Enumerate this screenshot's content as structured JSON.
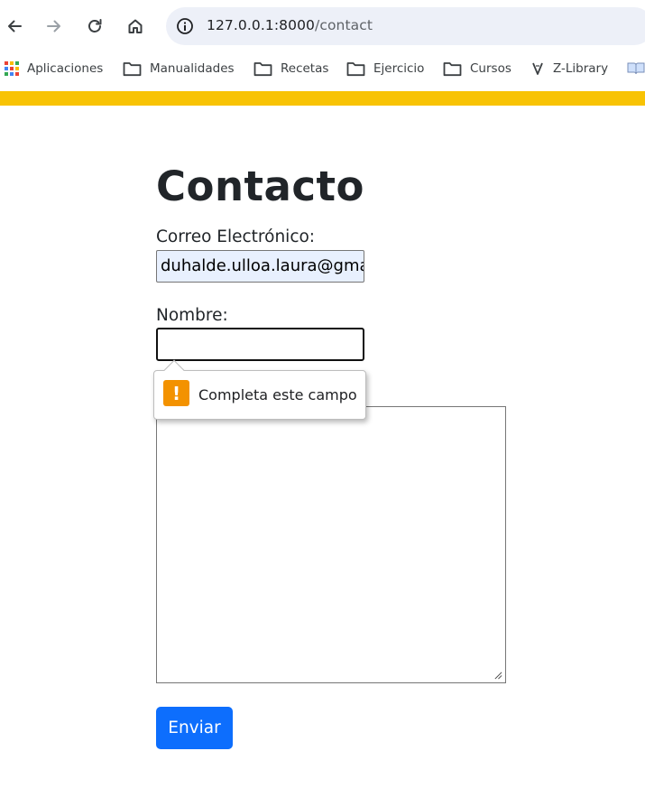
{
  "browser": {
    "url_host": "127.0.0.1:8000",
    "url_path": "/contact",
    "icons": {
      "back": "arrow-left-icon",
      "forward": "arrow-right-icon",
      "reload": "reload-icon",
      "home": "home-icon",
      "site_info": "info-icon"
    }
  },
  "bookmarks": [
    {
      "label": "Aplicaciones",
      "icon": "apps-grid-icon"
    },
    {
      "label": "Manualidades",
      "icon": "folder-icon"
    },
    {
      "label": "Recetas",
      "icon": "folder-icon"
    },
    {
      "label": "Ejercicio",
      "icon": "folder-icon"
    },
    {
      "label": "Cursos",
      "icon": "folder-icon"
    },
    {
      "label": "Z-Library",
      "icon": "z-library-icon"
    },
    {
      "label": "",
      "icon": "book-icon"
    }
  ],
  "colors": {
    "accent_strip": "#f8c304",
    "primary_button": "#0d6efd",
    "warning": "#f39200",
    "autofill_bg": "#e8f0fe"
  },
  "contact": {
    "title": "Contacto",
    "email_label": "Correo Electrónico:",
    "email_value": "duhalde.ulloa.laura@gma",
    "name_label": "Nombre:",
    "name_value": "",
    "message_value": "",
    "submit_label": "Enviar"
  },
  "validation": {
    "icon": "!",
    "message": "Completa este campo"
  }
}
